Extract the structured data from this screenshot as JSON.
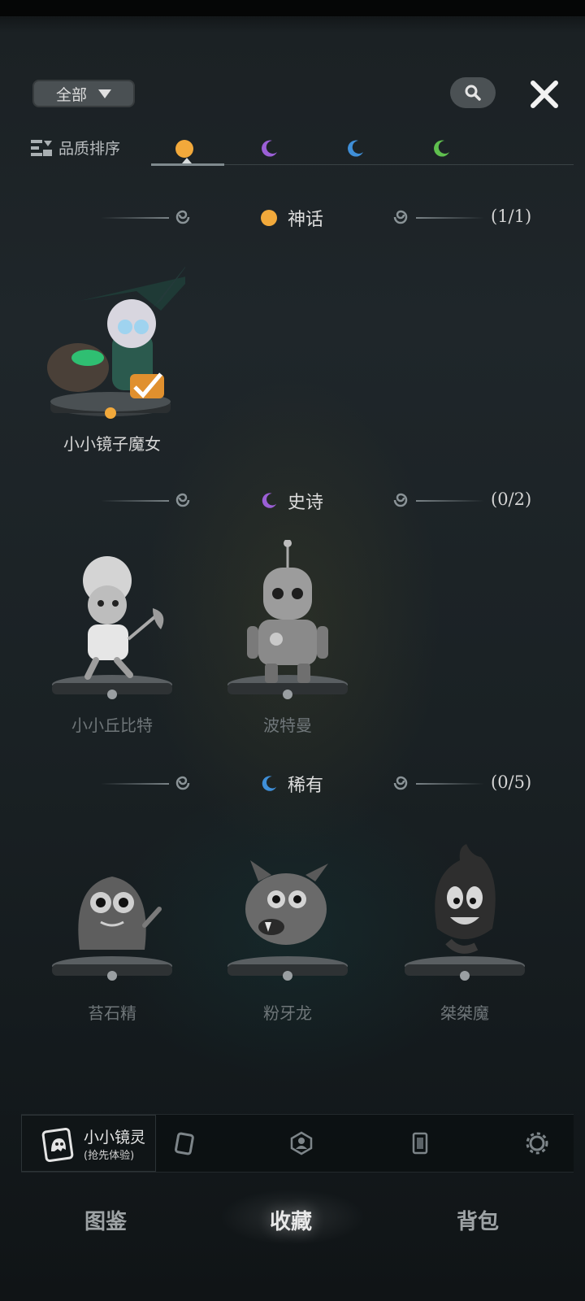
{
  "filter": {
    "label": "全部"
  },
  "sort": {
    "label": "品质排序"
  },
  "tabs": [
    {
      "name": "myth",
      "color": "#f2a93b"
    },
    {
      "name": "epic",
      "color": "#9b5fd6"
    },
    {
      "name": "rare",
      "color": "#3f8fd8"
    },
    {
      "name": "common",
      "color": "#5fbf4e"
    }
  ],
  "sections": [
    {
      "title": "神话",
      "count": "(1/1)",
      "color": "#f2a93b",
      "items": [
        {
          "name": "小小镜子魔女",
          "owned": true
        }
      ]
    },
    {
      "title": "史诗",
      "count": "(0/2)",
      "color": "#9b5fd6",
      "items": [
        {
          "name": "小小丘比特",
          "owned": false
        },
        {
          "name": "波特曼",
          "owned": false
        }
      ]
    },
    {
      "title": "稀有",
      "count": "(0/5)",
      "color": "#3f8fd8",
      "items": [
        {
          "name": "苔石精",
          "owned": false
        },
        {
          "name": "粉牙龙",
          "owned": false
        },
        {
          "name": "桀桀魔",
          "owned": false
        }
      ]
    }
  ],
  "subnav": {
    "selected_title": "小小镜灵",
    "selected_subtitle": "(抢先体验)",
    "icons": [
      "card-icon",
      "portrait-icon",
      "cardback-icon",
      "gear-icon"
    ]
  },
  "bottom_tabs": {
    "tab1": "图鉴",
    "tab2": "收藏",
    "tab3": "背包"
  }
}
